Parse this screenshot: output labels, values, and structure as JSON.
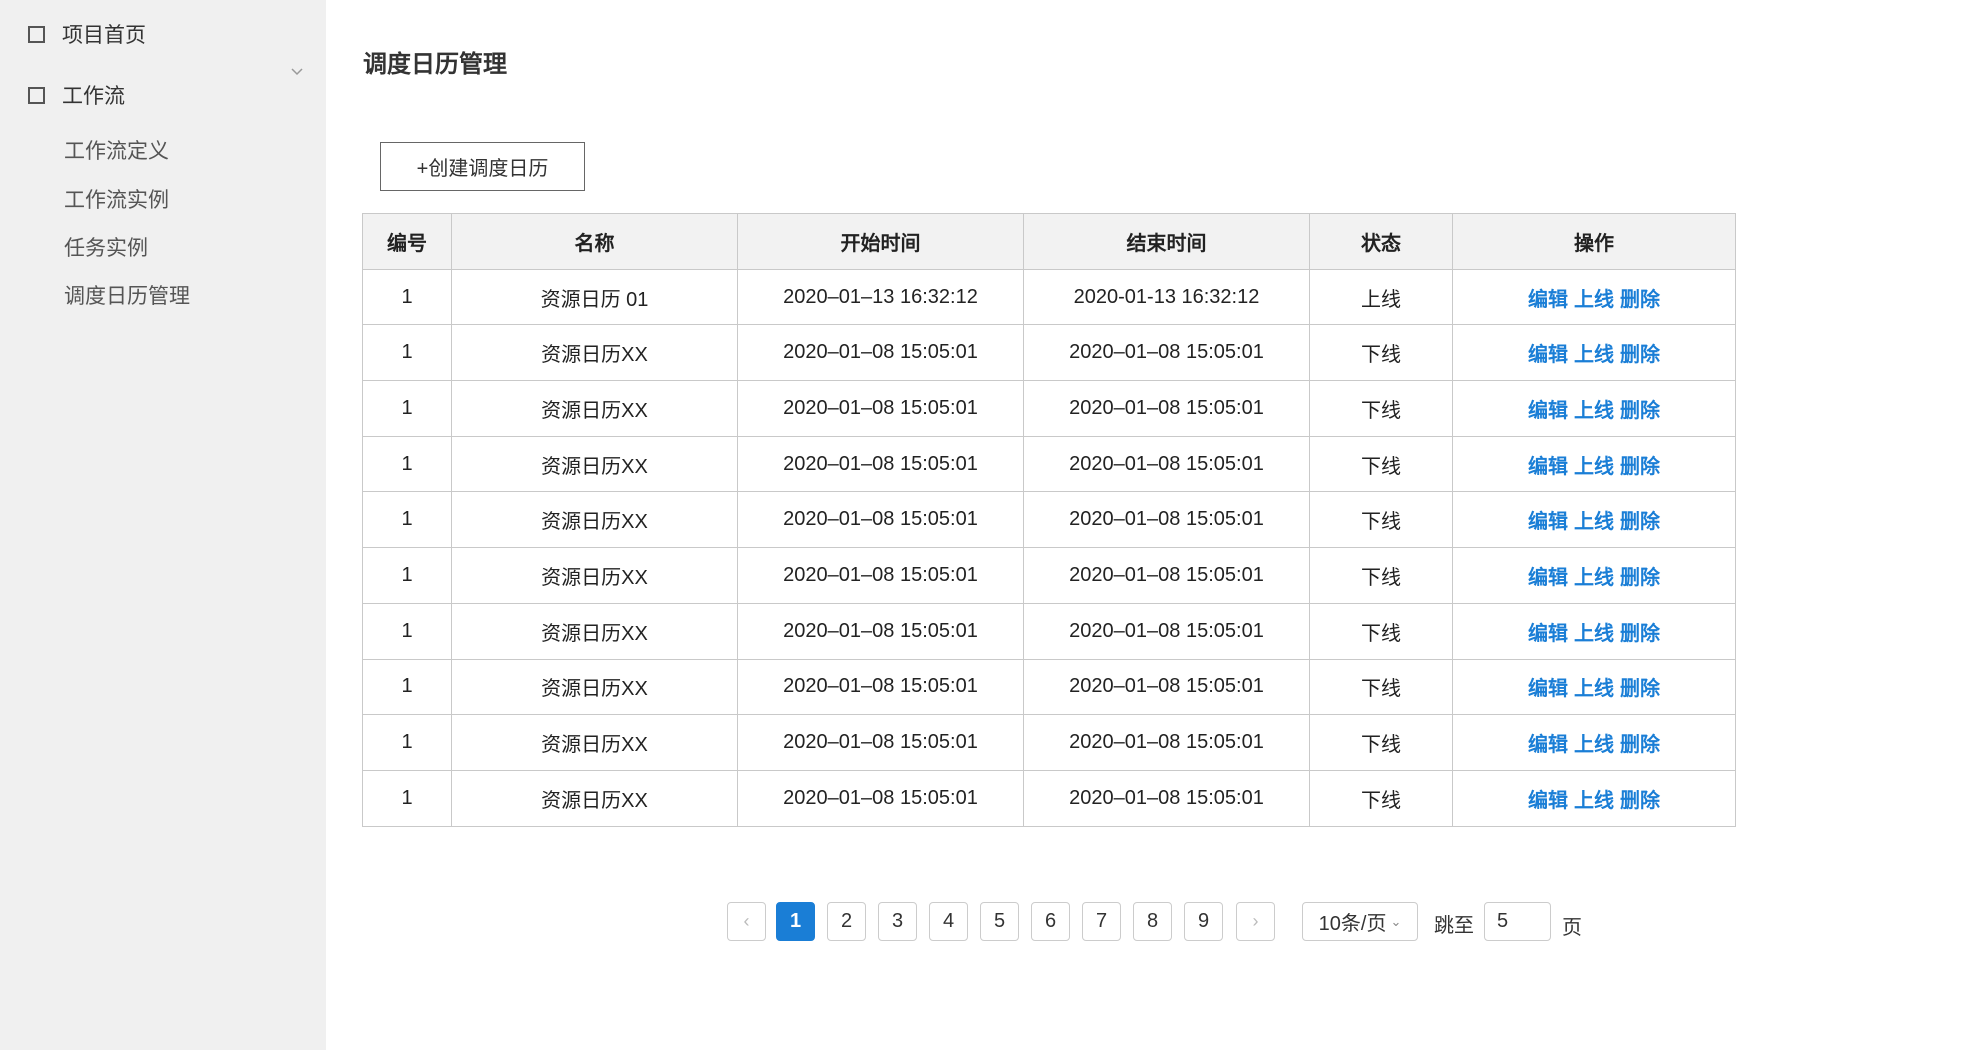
{
  "sidebar": {
    "home_label": "项目首页",
    "workflow_label": "工作流",
    "sub_items": [
      "工作流定义",
      "工作流实例",
      "任务实例",
      "调度日历管理"
    ]
  },
  "page": {
    "title": "调度日历管理",
    "create_button": "+创建调度日历"
  },
  "table": {
    "headers": [
      "编号",
      "名称",
      "开始时间",
      "结束时间",
      "状态",
      "操作"
    ],
    "actions": [
      "编辑",
      "上线",
      "删除"
    ],
    "rows": [
      {
        "id": "1",
        "name": "资源日历 01",
        "start": "2020–01–13 16:32:12",
        "end": "2020-01-13 16:32:12",
        "status": "上线"
      },
      {
        "id": "1",
        "name": "资源日历XX",
        "start": "2020–01–08 15:05:01",
        "end": "2020–01–08 15:05:01",
        "status": "下线"
      },
      {
        "id": "1",
        "name": "资源日历XX",
        "start": "2020–01–08 15:05:01",
        "end": "2020–01–08 15:05:01",
        "status": "下线"
      },
      {
        "id": "1",
        "name": "资源日历XX",
        "start": "2020–01–08 15:05:01",
        "end": "2020–01–08 15:05:01",
        "status": "下线"
      },
      {
        "id": "1",
        "name": "资源日历XX",
        "start": "2020–01–08 15:05:01",
        "end": "2020–01–08 15:05:01",
        "status": "下线"
      },
      {
        "id": "1",
        "name": "资源日历XX",
        "start": "2020–01–08 15:05:01",
        "end": "2020–01–08 15:05:01",
        "status": "下线"
      },
      {
        "id": "1",
        "name": "资源日历XX",
        "start": "2020–01–08 15:05:01",
        "end": "2020–01–08 15:05:01",
        "status": "下线"
      },
      {
        "id": "1",
        "name": "资源日历XX",
        "start": "2020–01–08 15:05:01",
        "end": "2020–01–08 15:05:01",
        "status": "下线"
      },
      {
        "id": "1",
        "name": "资源日历XX",
        "start": "2020–01–08 15:05:01",
        "end": "2020–01–08 15:05:01",
        "status": "下线"
      },
      {
        "id": "1",
        "name": "资源日历XX",
        "start": "2020–01–08 15:05:01",
        "end": "2020–01–08 15:05:01",
        "status": "下线"
      }
    ]
  },
  "pagination": {
    "prev_icon": "chevron-left-icon",
    "next_icon": "chevron-right-icon",
    "prev_glyph": "‹",
    "next_glyph": "›",
    "pages": [
      "1",
      "2",
      "3",
      "4",
      "5",
      "6",
      "7",
      "8",
      "9"
    ],
    "current_page": "1",
    "page_size": "10条/页",
    "jump_label": "跳至",
    "jump_value": "5",
    "page_suffix": "页"
  },
  "colors": {
    "accent": "#1a7ed6",
    "sidebar_bg": "#f0f0f0",
    "header_bg": "#f2f2f2"
  }
}
